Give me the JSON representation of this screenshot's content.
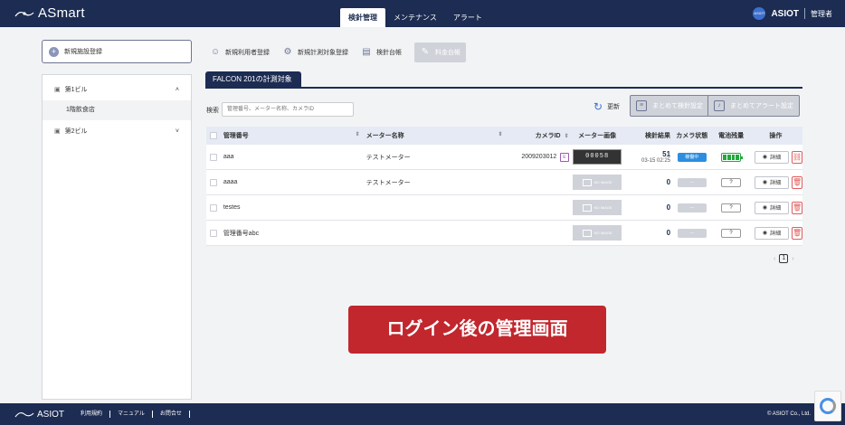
{
  "header": {
    "logo_text": "ASmart",
    "tabs": [
      {
        "label": "検針管理",
        "active": true
      },
      {
        "label": "メンテナンス",
        "active": false
      },
      {
        "label": "アラート",
        "active": false
      }
    ],
    "tenant_badge": "ASIOT",
    "tenant_name": "ASIOT",
    "role": "管理者"
  },
  "sidebar": {
    "add_facility_label": "新規施設登録",
    "buildings": [
      {
        "label": "第1ビル",
        "expanded": true,
        "children": [
          "1階飲食店"
        ]
      },
      {
        "label": "第2ビル",
        "expanded": false,
        "children": []
      }
    ]
  },
  "toolbar": {
    "items": [
      {
        "label": "新規利用者登録",
        "icon": "user-add-icon"
      },
      {
        "label": "新規計測対象登録",
        "icon": "meter-add-icon"
      },
      {
        "label": "検針台帳",
        "icon": "ledger-icon"
      },
      {
        "label": "料金台帳",
        "icon": "pen-icon",
        "disabled": true
      }
    ]
  },
  "target_tab": "FALCON 201の計測対象",
  "search": {
    "label": "検索",
    "placeholder": "管理番号、メーター名称、カメラID"
  },
  "refresh_label": "更新",
  "bulk_meter_label": "まとめて検針設定",
  "bulk_alert_label": "まとめてアラート設定",
  "table": {
    "headers": {
      "id": "管理番号",
      "name": "メーター名称",
      "camera": "カメラID",
      "image": "メーター画像",
      "result": "検針結果",
      "camera_status": "カメラ状態",
      "battery": "電池残量",
      "ops": "操作"
    },
    "rows": [
      {
        "id": "aaa",
        "name": "テストメーター",
        "camera": "2009203012",
        "camera_badge": "E",
        "image": "00058",
        "result": "51",
        "time": "03-15 02:25",
        "status": "稼働中",
        "status_on": true,
        "battery": "full",
        "detail": "詳細"
      },
      {
        "id": "aaaa",
        "name": "テストメーター",
        "camera": "",
        "image": "NO IMAGE",
        "result": "0",
        "time": "",
        "status": "---",
        "status_on": false,
        "battery": "?",
        "detail": "詳細"
      },
      {
        "id": "testes",
        "name": "",
        "camera": "",
        "image": "NO IMAGE",
        "result": "0",
        "time": "",
        "status": "---",
        "status_on": false,
        "battery": "?",
        "detail": "詳細"
      },
      {
        "id": "管理番号abc",
        "name": "",
        "camera": "",
        "image": "NO IMAGE",
        "result": "0",
        "time": "",
        "status": "---",
        "status_on": false,
        "battery": "?",
        "detail": "詳細"
      }
    ]
  },
  "pager": {
    "current": "1",
    "prev": "‹",
    "next": "›"
  },
  "overlay_label": "ログイン後の管理画面",
  "footer": {
    "logo_text": "ASIOT",
    "links": [
      "利用規約",
      "マニュアル",
      "お問合せ"
    ],
    "copyright": "© ASIOT Co., Ltd."
  }
}
